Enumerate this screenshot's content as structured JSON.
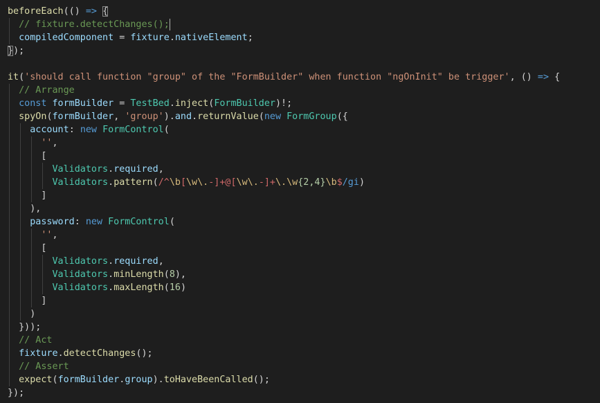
{
  "editor": {
    "colors": {
      "background": "#1e1e1e",
      "function": "#dcdcaa",
      "plain": "#d4d4d4",
      "keyword": "#569cd6",
      "variable": "#9cdcfe",
      "type": "#4ec9b0",
      "string": "#ce9178",
      "comment": "#6a9955",
      "number": "#b5cea8",
      "regex": "#d16969",
      "regex_class": "#d7ba7d"
    },
    "lines": [
      [
        [
          "fn",
          "beforeEach"
        ],
        [
          "pl",
          "(() "
        ],
        [
          "kw",
          "=>"
        ],
        [
          "pl",
          " "
        ],
        [
          "br",
          "{"
        ]
      ],
      [
        [
          "pl",
          "  "
        ],
        [
          "cm",
          "// fixture.detectChanges();"
        ],
        [
          "cursor",
          ""
        ]
      ],
      [
        [
          "pl",
          "  "
        ],
        [
          "var",
          "compiledComponent"
        ],
        [
          "pl",
          " = "
        ],
        [
          "var",
          "fixture"
        ],
        [
          "pl",
          "."
        ],
        [
          "var",
          "nativeElement"
        ],
        [
          "pl",
          ";"
        ]
      ],
      [
        [
          "br",
          "}"
        ],
        [
          "pl",
          ");"
        ]
      ],
      [
        [
          "pl",
          ""
        ]
      ],
      [
        [
          "fn",
          "it"
        ],
        [
          "pl",
          "("
        ],
        [
          "str",
          "'should call function \"group\" of the \"FormBuilder\" when function \"ngOnInit\" be trigger'"
        ],
        [
          "pl",
          ", () "
        ],
        [
          "kw",
          "=>"
        ],
        [
          "pl",
          " {"
        ]
      ],
      [
        [
          "pl",
          "  "
        ],
        [
          "cm",
          "// Arrange"
        ]
      ],
      [
        [
          "pl",
          "  "
        ],
        [
          "kw",
          "const"
        ],
        [
          "pl",
          " "
        ],
        [
          "var",
          "formBuilder"
        ],
        [
          "pl",
          " = "
        ],
        [
          "ty",
          "TestBed"
        ],
        [
          "pl",
          "."
        ],
        [
          "fn",
          "inject"
        ],
        [
          "pl",
          "("
        ],
        [
          "ty",
          "FormBuilder"
        ],
        [
          "pl",
          ")!;"
        ]
      ],
      [
        [
          "pl",
          "  "
        ],
        [
          "fn",
          "spyOn"
        ],
        [
          "pl",
          "("
        ],
        [
          "var",
          "formBuilder"
        ],
        [
          "pl",
          ", "
        ],
        [
          "str",
          "'group'"
        ],
        [
          "pl",
          ")."
        ],
        [
          "var",
          "and"
        ],
        [
          "pl",
          "."
        ],
        [
          "fn",
          "returnValue"
        ],
        [
          "pl",
          "("
        ],
        [
          "kw",
          "new"
        ],
        [
          "pl",
          " "
        ],
        [
          "ty",
          "FormGroup"
        ],
        [
          "pl",
          "({"
        ]
      ],
      [
        [
          "pl",
          "    "
        ],
        [
          "var",
          "account"
        ],
        [
          "pl",
          ": "
        ],
        [
          "kw",
          "new"
        ],
        [
          "pl",
          " "
        ],
        [
          "ty",
          "FormControl"
        ],
        [
          "pl",
          "("
        ]
      ],
      [
        [
          "pl",
          "      "
        ],
        [
          "str",
          "''"
        ],
        [
          "pl",
          ","
        ]
      ],
      [
        [
          "pl",
          "      ["
        ]
      ],
      [
        [
          "pl",
          "        "
        ],
        [
          "ty",
          "Validators"
        ],
        [
          "pl",
          "."
        ],
        [
          "var",
          "required"
        ],
        [
          "pl",
          ","
        ]
      ],
      [
        [
          "pl",
          "        "
        ],
        [
          "ty",
          "Validators"
        ],
        [
          "pl",
          "."
        ],
        [
          "fn",
          "pattern"
        ],
        [
          "pl",
          "("
        ],
        [
          "rx",
          "/^"
        ],
        [
          "rxc",
          "\\b"
        ],
        [
          "rx",
          "["
        ],
        [
          "rxc",
          "\\w\\."
        ],
        [
          "rx",
          "-]+@["
        ],
        [
          "rxc",
          "\\w\\."
        ],
        [
          "rx",
          "-]+"
        ],
        [
          "rxc",
          "\\."
        ],
        [
          "rxc",
          "\\w"
        ],
        [
          "num",
          "{2,4}"
        ],
        [
          "rxc",
          "\\b"
        ],
        [
          "rx",
          "$"
        ],
        [
          "kw",
          "/gi"
        ],
        [
          "pl",
          ")"
        ]
      ],
      [
        [
          "pl",
          "      ]"
        ]
      ],
      [
        [
          "pl",
          "    ),"
        ]
      ],
      [
        [
          "pl",
          "    "
        ],
        [
          "var",
          "password"
        ],
        [
          "pl",
          ": "
        ],
        [
          "kw",
          "new"
        ],
        [
          "pl",
          " "
        ],
        [
          "ty",
          "FormControl"
        ],
        [
          "pl",
          "("
        ]
      ],
      [
        [
          "pl",
          "      "
        ],
        [
          "str",
          "''"
        ],
        [
          "pl",
          ","
        ]
      ],
      [
        [
          "pl",
          "      ["
        ]
      ],
      [
        [
          "pl",
          "        "
        ],
        [
          "ty",
          "Validators"
        ],
        [
          "pl",
          "."
        ],
        [
          "var",
          "required"
        ],
        [
          "pl",
          ","
        ]
      ],
      [
        [
          "pl",
          "        "
        ],
        [
          "ty",
          "Validators"
        ],
        [
          "pl",
          "."
        ],
        [
          "fn",
          "minLength"
        ],
        [
          "pl",
          "("
        ],
        [
          "num",
          "8"
        ],
        [
          "pl",
          "),"
        ]
      ],
      [
        [
          "pl",
          "        "
        ],
        [
          "ty",
          "Validators"
        ],
        [
          "pl",
          "."
        ],
        [
          "fn",
          "maxLength"
        ],
        [
          "pl",
          "("
        ],
        [
          "num",
          "16"
        ],
        [
          "pl",
          ")"
        ]
      ],
      [
        [
          "pl",
          "      ]"
        ]
      ],
      [
        [
          "pl",
          "    )"
        ]
      ],
      [
        [
          "pl",
          "  }));"
        ]
      ],
      [
        [
          "pl",
          "  "
        ],
        [
          "cm",
          "// Act"
        ]
      ],
      [
        [
          "pl",
          "  "
        ],
        [
          "var",
          "fixture"
        ],
        [
          "pl",
          "."
        ],
        [
          "fn",
          "detectChanges"
        ],
        [
          "pl",
          "();"
        ]
      ],
      [
        [
          "pl",
          "  "
        ],
        [
          "cm",
          "// Assert"
        ]
      ],
      [
        [
          "pl",
          "  "
        ],
        [
          "fn",
          "expect"
        ],
        [
          "pl",
          "("
        ],
        [
          "var",
          "formBuilder"
        ],
        [
          "pl",
          "."
        ],
        [
          "var",
          "group"
        ],
        [
          "pl",
          ")."
        ],
        [
          "fn",
          "toHaveBeenCalled"
        ],
        [
          "pl",
          "();"
        ]
      ],
      [
        [
          "pl",
          "});"
        ]
      ]
    ]
  }
}
